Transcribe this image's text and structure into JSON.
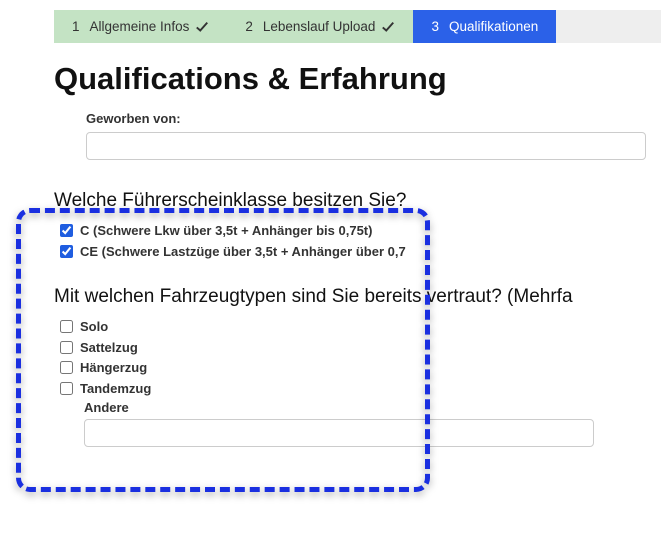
{
  "steps": [
    {
      "num": "1",
      "label": "Allgemeine Infos",
      "state": "completed"
    },
    {
      "num": "2",
      "label": "Lebenslauf Upload",
      "state": "completed"
    },
    {
      "num": "3",
      "label": "Qualifikationen",
      "state": "active"
    }
  ],
  "title": "Qualifications & Erfahrung",
  "geworben_label": "Geworben von:",
  "geworben_value": "",
  "q_license": {
    "title": "Welche Führerscheinklasse besitzen Sie?",
    "options": [
      {
        "label": "C (Schwere Lkw über 3,5t + Anhänger bis 0,75t)",
        "checked": true
      },
      {
        "label": "CE (Schwere Lastzüge über 3,5t + Anhänger über 0,7",
        "checked": true
      }
    ]
  },
  "q_vehicle": {
    "title": "Mit welchen Fahrzeugtypen sind Sie bereits vertraut? (Mehrfa",
    "options": [
      {
        "label": "Solo",
        "checked": false
      },
      {
        "label": "Sattelzug",
        "checked": false
      },
      {
        "label": "Hängerzug",
        "checked": false
      },
      {
        "label": "Tandemzug",
        "checked": false
      }
    ],
    "andere_label": "Andere",
    "andere_value": ""
  }
}
